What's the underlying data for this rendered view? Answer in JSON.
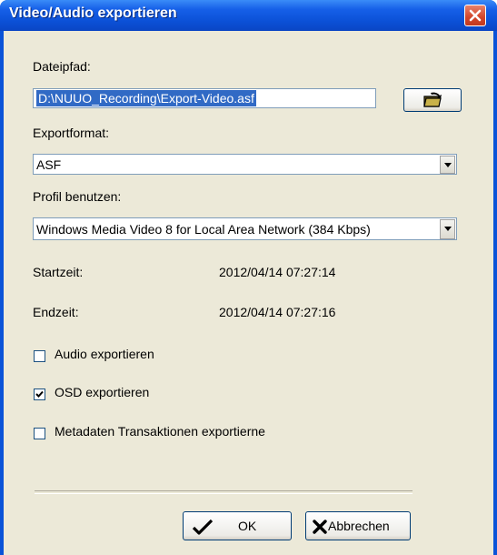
{
  "window": {
    "title": "Video/Audio exportieren"
  },
  "file_path": {
    "label": "Dateipfad:",
    "value": "D:\\NUUO_Recording\\Export-Video.asf"
  },
  "export_format": {
    "label": "Exportformat:",
    "selected": "ASF"
  },
  "profile": {
    "label": "Profil benutzen:",
    "selected": "Windows Media Video 8 for Local Area Network (384 Kbps)"
  },
  "start_time": {
    "label": "Startzeit:",
    "value": "2012/04/14 07:27:14"
  },
  "end_time": {
    "label": "Endzeit:",
    "value": "2012/04/14 07:27:16"
  },
  "checkboxes": [
    {
      "label": "Audio exportieren",
      "checked": false
    },
    {
      "label": "OSD exportieren",
      "checked": true
    },
    {
      "label": "Metadaten Transaktionen exportierne",
      "checked": false
    }
  ],
  "buttons": {
    "ok": "OK",
    "cancel": "Abbrechen"
  },
  "icons": {
    "close": "close-icon",
    "browse": "open-folder-icon",
    "ok": "checkmark-icon",
    "cancel": "x-mark-icon",
    "dropdown": "chevron-down-icon"
  },
  "colors": {
    "titlebar": "#0b50d6",
    "dialog_bg": "#ece9d8",
    "close_button": "#d2452a",
    "selection": "#316ac5"
  }
}
